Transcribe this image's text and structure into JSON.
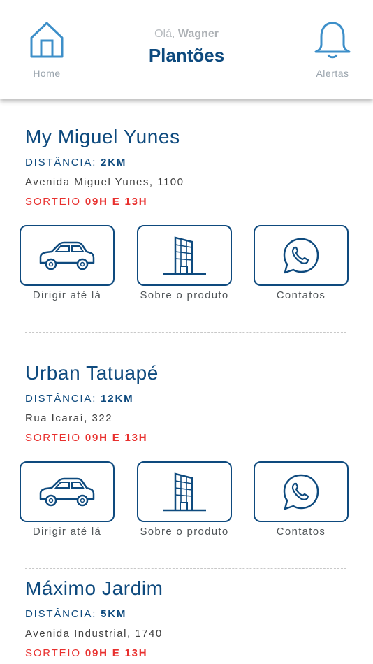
{
  "header": {
    "greeting": "Olá,",
    "user": "Wagner",
    "title": "Plantões",
    "home_label": "Home",
    "alerts_label": "Alertas"
  },
  "labels": {
    "distance": "DISTÂNCIA:",
    "sorteio": "SORTEIO",
    "drive": "Dirigir até lá",
    "about": "Sobre o produto",
    "contacts": "Contatos"
  },
  "colors": {
    "primary": "#0e4a7e",
    "accent_red": "#e8302e",
    "icon_blue": "#3d8fc9"
  },
  "plantoes": [
    {
      "name": "My Miguel Yunes",
      "distance": "2KM",
      "address": "Avenida Miguel Yunes, 1100",
      "sorteio": "09H E 13H"
    },
    {
      "name": "Urban Tatuapé",
      "distance": "12KM",
      "address": "Rua Icaraí, 322",
      "sorteio": "09H E 13H"
    },
    {
      "name": "Máximo Jardim",
      "distance": "5KM",
      "address": "Avenida Industrial, 1740",
      "sorteio": "09H E 13H"
    }
  ]
}
